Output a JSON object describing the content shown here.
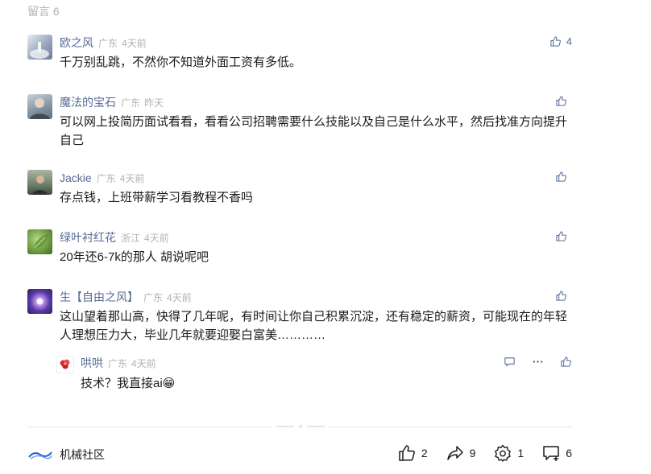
{
  "section": {
    "title": "留言 6"
  },
  "comments": [
    {
      "nick": "欧之风",
      "location": "广东",
      "time": "4天前",
      "text": "千万别乱跳，不然你不知道外面工资有多低。",
      "likes": "4",
      "avatar_colors": [
        "#9aa7be",
        "#e8ecf2"
      ]
    },
    {
      "nick": "魔法的宝石",
      "location": "广东",
      "time": "昨天",
      "text": "可以网上投简历面试看看，看看公司招聘需要什么技能以及自己是什么水平，然后找准方向提升自己",
      "likes": "",
      "avatar_colors": [
        "#5b6f7e",
        "#c9d3d9"
      ]
    },
    {
      "nick": "Jackie",
      "location": "广东",
      "time": "4天前",
      "text": "存点钱，上班带薪学习看教程不香吗",
      "likes": "",
      "avatar_colors": [
        "#3b4a3a",
        "#a8b7a2"
      ]
    },
    {
      "nick": "绿叶衬红花",
      "location": "浙江",
      "time": "4天前",
      "text": "20年还6-7k的那人 胡说呢吧",
      "likes": "",
      "avatar_colors": [
        "#4d7a2f",
        "#9dc56a"
      ]
    },
    {
      "nick": "生【自由之风】",
      "location": "广东",
      "time": "4天前",
      "text": "这山望着那山高，快得了几年呢，有时间让你自己积累沉淀，还有稳定的薪资，可能现在的年轻人理想压力大，毕业几年就要迎娶白富美…………",
      "likes": "",
      "avatar_colors": [
        "#2a1f5e",
        "#b98be6"
      ]
    }
  ],
  "reply": {
    "nick": "哄哄",
    "location": "广东",
    "time": "4天前",
    "text": "技术？我直接ai😁",
    "avatar_colors": [
      "#ffffff",
      "#d9263a"
    ]
  },
  "footer": {
    "brand_name": "机械社区",
    "like_count": "2",
    "share_count": "9",
    "recommend_count": "1",
    "comment_count": "6"
  },
  "colors": {
    "nick": "#576b95",
    "meta": "#b2b2b2",
    "text": "#1a1a1a",
    "divider": "#e5e5e5"
  },
  "icons": [
    "thumb-up-icon",
    "comment-icon",
    "more-icon",
    "share-icon",
    "recommend-icon",
    "add-comment-icon"
  ]
}
